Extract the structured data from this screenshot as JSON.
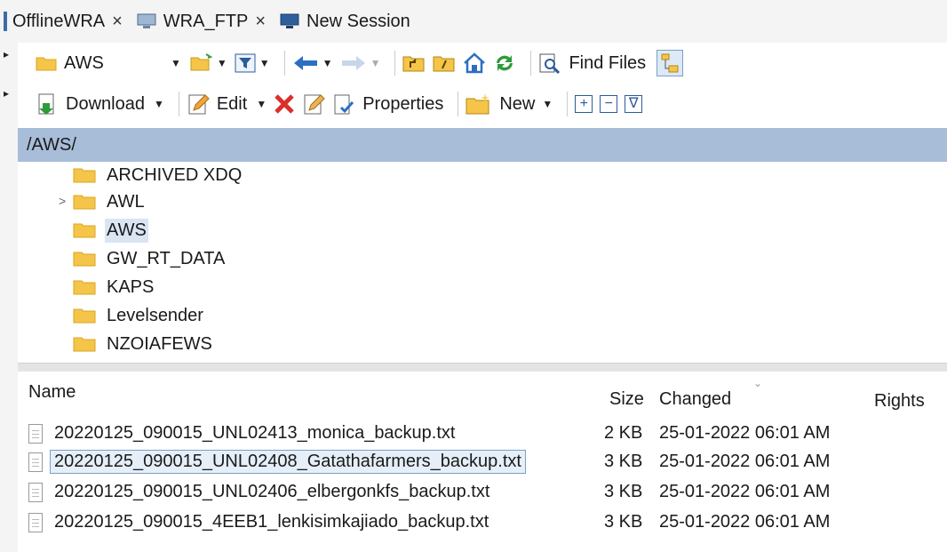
{
  "tabs": [
    {
      "label": "OfflineWRA",
      "close": "×"
    },
    {
      "label": "WRA_FTP",
      "close": "×"
    },
    {
      "label": "New Session"
    }
  ],
  "toolbar1": {
    "path_label": "AWS",
    "find_files_label": "Find Files"
  },
  "toolbar2": {
    "download_label": "Download",
    "edit_label": "Edit",
    "properties_label": "Properties",
    "new_label": "New",
    "plus_label": "+",
    "minus_label": "−",
    "filter_label": "∇"
  },
  "pathbar": {
    "path": "/AWS/"
  },
  "tree": {
    "items": [
      {
        "label": "ARCHIVED XDQ"
      },
      {
        "label": "AWL",
        "expander": ">"
      },
      {
        "label": "AWS",
        "selected": true
      },
      {
        "label": "GW_RT_DATA"
      },
      {
        "label": "KAPS"
      },
      {
        "label": "Levelsender"
      },
      {
        "label": "NZOIAFEWS"
      }
    ]
  },
  "filelist": {
    "columns": {
      "name": "Name",
      "size": "Size",
      "changed": "Changed",
      "rights": "Rights"
    },
    "rows": [
      {
        "name": "20220125_090015_UNL02413_monica_backup.txt",
        "size": "2 KB",
        "changed": "25-01-2022 06:01 AM"
      },
      {
        "name": "20220125_090015_UNL02408_Gatathafarmers_backup.txt",
        "size": "3 KB",
        "changed": "25-01-2022 06:01 AM",
        "selected": true
      },
      {
        "name": "20220125_090015_UNL02406_elbergonkfs_backup.txt",
        "size": "3 KB",
        "changed": "25-01-2022 06:01 AM"
      },
      {
        "name": "20220125_090015_4EEB1_lenkisimkajiado_backup.txt",
        "size": "3 KB",
        "changed": "25-01-2022 06:01 AM"
      }
    ]
  },
  "colors": {
    "pathbar_bg": "#a7bdd8",
    "selection_bg": "#d9e5f3",
    "folder_yellow": "#f5c54a",
    "delete_red": "#d9302c",
    "nav_blue": "#2c6fc2"
  }
}
